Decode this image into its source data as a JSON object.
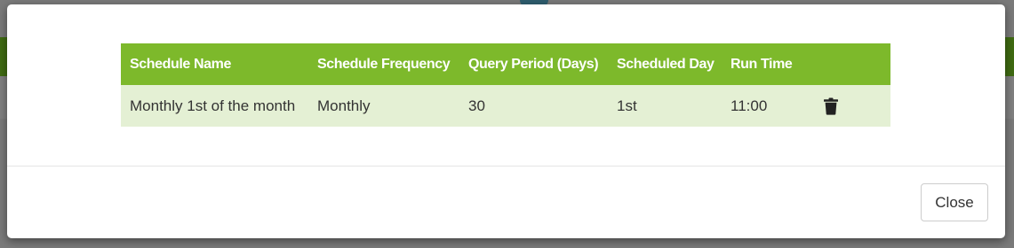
{
  "table": {
    "headers": {
      "schedule_name": "Schedule Name",
      "schedule_frequency": "Schedule Frequency",
      "query_period": "Query Period (Days)",
      "scheduled_day": "Scheduled Day",
      "run_time": "Run Time"
    },
    "rows": [
      {
        "schedule_name": "Monthly 1st of the month",
        "schedule_frequency": "Monthly",
        "query_period": "30",
        "scheduled_day": "1st",
        "run_time": "11:00",
        "action_icon": "trash-icon"
      }
    ]
  },
  "footer": {
    "close_label": "Close"
  },
  "colors": {
    "header_bg": "#7db92b",
    "row_bg": "#e4f0d4",
    "background_bar": "#3f6b12"
  }
}
